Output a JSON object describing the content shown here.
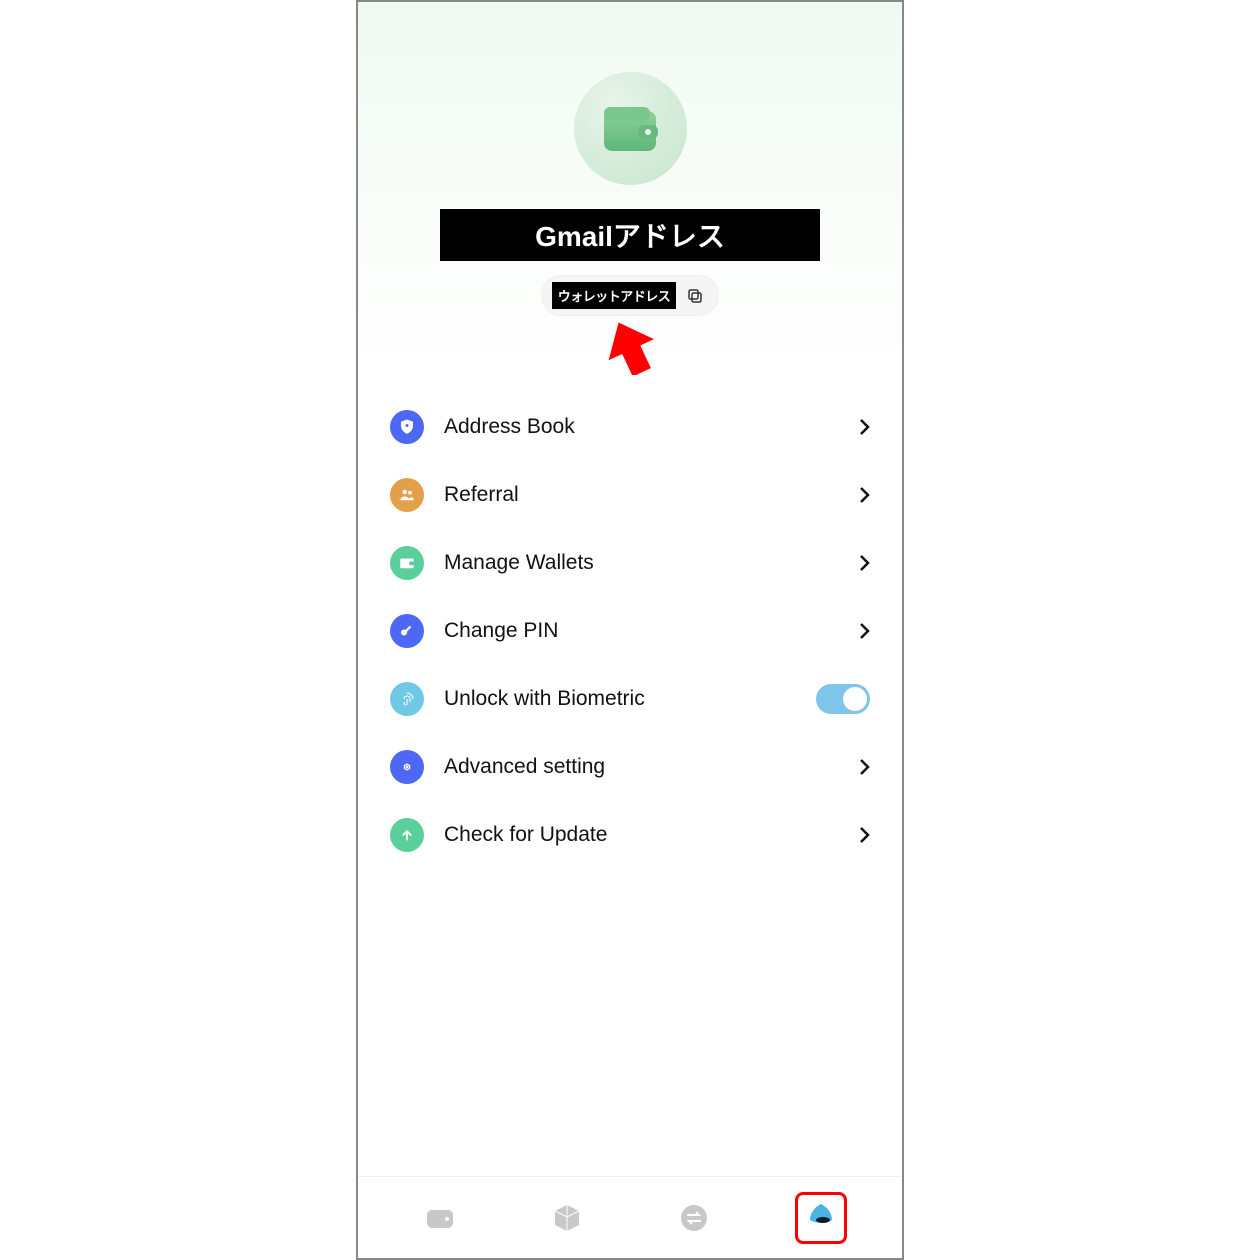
{
  "header": {
    "email_label": "Gmailアドレス",
    "wallet_address_label": "ウォレットアドレス"
  },
  "menu": {
    "items": [
      {
        "id": "address-book",
        "label": "Address Book",
        "icon": "shield-icon",
        "color": "#4d68f5",
        "action": "chevron"
      },
      {
        "id": "referral",
        "label": "Referral",
        "icon": "people-icon",
        "color": "#e3a04a",
        "action": "chevron"
      },
      {
        "id": "manage-wallets",
        "label": "Manage Wallets",
        "icon": "wallet-small-icon",
        "color": "#5bcf9b",
        "action": "chevron"
      },
      {
        "id": "change-pin",
        "label": "Change PIN",
        "icon": "key-icon",
        "color": "#4d68f5",
        "action": "chevron"
      },
      {
        "id": "biometric",
        "label": "Unlock with Biometric",
        "icon": "fingerprint-icon",
        "color": "#6fc9e6",
        "action": "toggle",
        "toggle_on": true
      },
      {
        "id": "advanced",
        "label": "Advanced setting",
        "icon": "gear-icon",
        "color": "#4d68f5",
        "action": "chevron"
      },
      {
        "id": "update",
        "label": "Check for Update",
        "icon": "update-icon",
        "color": "#5bcf9b",
        "action": "chevron"
      }
    ]
  },
  "bottom_nav": {
    "items": [
      {
        "id": "wallet",
        "icon": "wallet-nav-icon",
        "active": false
      },
      {
        "id": "cube",
        "icon": "cube-nav-icon",
        "active": false
      },
      {
        "id": "swap",
        "icon": "swap-nav-icon",
        "active": false
      },
      {
        "id": "dolphin",
        "icon": "dolphin-nav-icon",
        "active": true
      }
    ]
  },
  "annotations": {
    "arrow_color": "#ff0000"
  }
}
